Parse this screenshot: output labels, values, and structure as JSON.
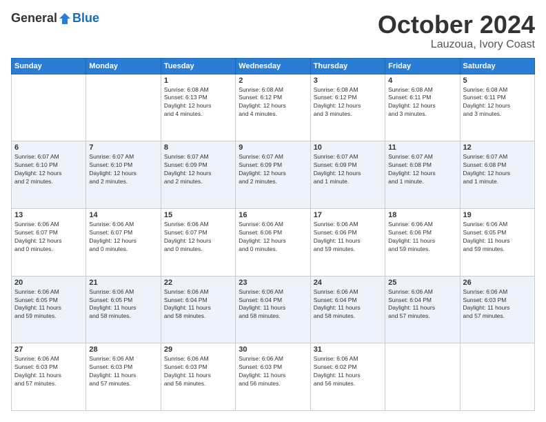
{
  "header": {
    "logo": {
      "general": "General",
      "blue": "Blue"
    },
    "title": "October 2024",
    "location": "Lauzoua, Ivory Coast"
  },
  "days_header": [
    "Sunday",
    "Monday",
    "Tuesday",
    "Wednesday",
    "Thursday",
    "Friday",
    "Saturday"
  ],
  "weeks": [
    [
      {
        "day": "",
        "info": ""
      },
      {
        "day": "",
        "info": ""
      },
      {
        "day": "1",
        "info": "Sunrise: 6:08 AM\nSunset: 6:13 PM\nDaylight: 12 hours\nand 4 minutes."
      },
      {
        "day": "2",
        "info": "Sunrise: 6:08 AM\nSunset: 6:12 PM\nDaylight: 12 hours\nand 4 minutes."
      },
      {
        "day": "3",
        "info": "Sunrise: 6:08 AM\nSunset: 6:12 PM\nDaylight: 12 hours\nand 3 minutes."
      },
      {
        "day": "4",
        "info": "Sunrise: 6:08 AM\nSunset: 6:11 PM\nDaylight: 12 hours\nand 3 minutes."
      },
      {
        "day": "5",
        "info": "Sunrise: 6:08 AM\nSunset: 6:11 PM\nDaylight: 12 hours\nand 3 minutes."
      }
    ],
    [
      {
        "day": "6",
        "info": "Sunrise: 6:07 AM\nSunset: 6:10 PM\nDaylight: 12 hours\nand 2 minutes."
      },
      {
        "day": "7",
        "info": "Sunrise: 6:07 AM\nSunset: 6:10 PM\nDaylight: 12 hours\nand 2 minutes."
      },
      {
        "day": "8",
        "info": "Sunrise: 6:07 AM\nSunset: 6:09 PM\nDaylight: 12 hours\nand 2 minutes."
      },
      {
        "day": "9",
        "info": "Sunrise: 6:07 AM\nSunset: 6:09 PM\nDaylight: 12 hours\nand 2 minutes."
      },
      {
        "day": "10",
        "info": "Sunrise: 6:07 AM\nSunset: 6:09 PM\nDaylight: 12 hours\nand 1 minute."
      },
      {
        "day": "11",
        "info": "Sunrise: 6:07 AM\nSunset: 6:08 PM\nDaylight: 12 hours\nand 1 minute."
      },
      {
        "day": "12",
        "info": "Sunrise: 6:07 AM\nSunset: 6:08 PM\nDaylight: 12 hours\nand 1 minute."
      }
    ],
    [
      {
        "day": "13",
        "info": "Sunrise: 6:06 AM\nSunset: 6:07 PM\nDaylight: 12 hours\nand 0 minutes."
      },
      {
        "day": "14",
        "info": "Sunrise: 6:06 AM\nSunset: 6:07 PM\nDaylight: 12 hours\nand 0 minutes."
      },
      {
        "day": "15",
        "info": "Sunrise: 6:06 AM\nSunset: 6:07 PM\nDaylight: 12 hours\nand 0 minutes."
      },
      {
        "day": "16",
        "info": "Sunrise: 6:06 AM\nSunset: 6:06 PM\nDaylight: 12 hours\nand 0 minutes."
      },
      {
        "day": "17",
        "info": "Sunrise: 6:06 AM\nSunset: 6:06 PM\nDaylight: 11 hours\nand 59 minutes."
      },
      {
        "day": "18",
        "info": "Sunrise: 6:06 AM\nSunset: 6:06 PM\nDaylight: 11 hours\nand 59 minutes."
      },
      {
        "day": "19",
        "info": "Sunrise: 6:06 AM\nSunset: 6:05 PM\nDaylight: 11 hours\nand 59 minutes."
      }
    ],
    [
      {
        "day": "20",
        "info": "Sunrise: 6:06 AM\nSunset: 6:05 PM\nDaylight: 11 hours\nand 59 minutes."
      },
      {
        "day": "21",
        "info": "Sunrise: 6:06 AM\nSunset: 6:05 PM\nDaylight: 11 hours\nand 58 minutes."
      },
      {
        "day": "22",
        "info": "Sunrise: 6:06 AM\nSunset: 6:04 PM\nDaylight: 11 hours\nand 58 minutes."
      },
      {
        "day": "23",
        "info": "Sunrise: 6:06 AM\nSunset: 6:04 PM\nDaylight: 11 hours\nand 58 minutes."
      },
      {
        "day": "24",
        "info": "Sunrise: 6:06 AM\nSunset: 6:04 PM\nDaylight: 11 hours\nand 58 minutes."
      },
      {
        "day": "25",
        "info": "Sunrise: 6:06 AM\nSunset: 6:04 PM\nDaylight: 11 hours\nand 57 minutes."
      },
      {
        "day": "26",
        "info": "Sunrise: 6:06 AM\nSunset: 6:03 PM\nDaylight: 11 hours\nand 57 minutes."
      }
    ],
    [
      {
        "day": "27",
        "info": "Sunrise: 6:06 AM\nSunset: 6:03 PM\nDaylight: 11 hours\nand 57 minutes."
      },
      {
        "day": "28",
        "info": "Sunrise: 6:06 AM\nSunset: 6:03 PM\nDaylight: 11 hours\nand 57 minutes."
      },
      {
        "day": "29",
        "info": "Sunrise: 6:06 AM\nSunset: 6:03 PM\nDaylight: 11 hours\nand 56 minutes."
      },
      {
        "day": "30",
        "info": "Sunrise: 6:06 AM\nSunset: 6:03 PM\nDaylight: 11 hours\nand 56 minutes."
      },
      {
        "day": "31",
        "info": "Sunrise: 6:06 AM\nSunset: 6:02 PM\nDaylight: 11 hours\nand 56 minutes."
      },
      {
        "day": "",
        "info": ""
      },
      {
        "day": "",
        "info": ""
      }
    ]
  ]
}
